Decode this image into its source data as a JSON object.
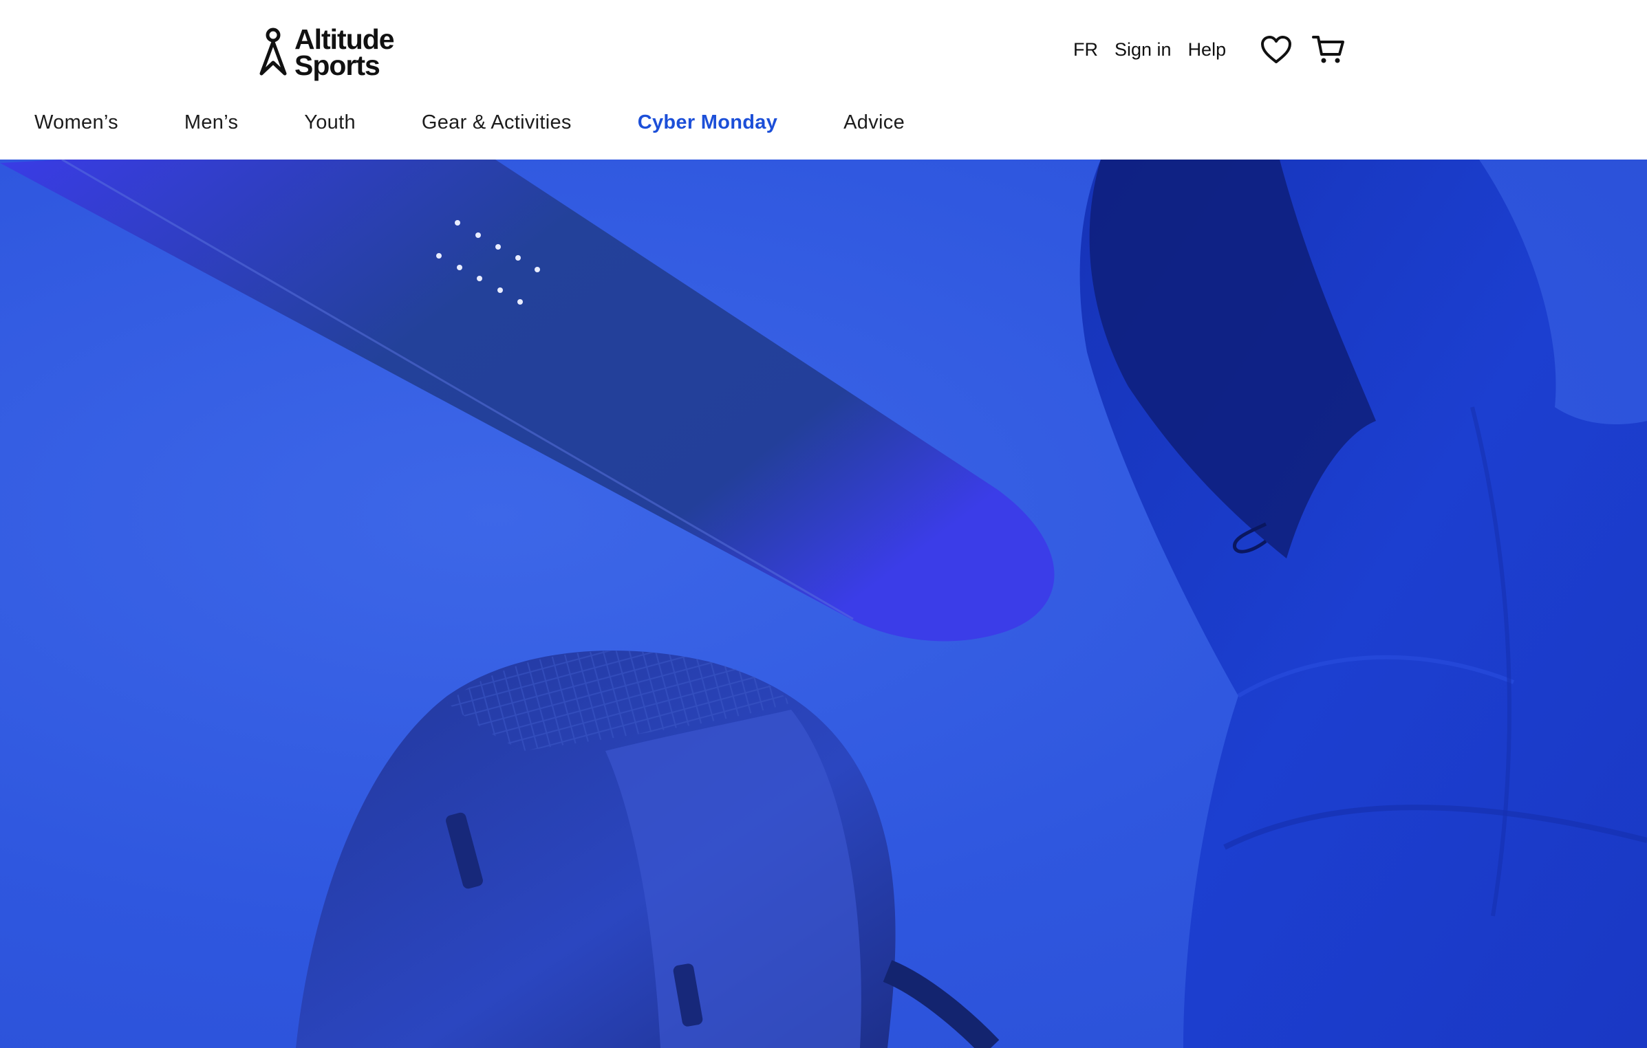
{
  "brand": {
    "name_line1": "Altitude",
    "name_line2": "Sports",
    "logo_icon": "altitude-sports-logo-icon"
  },
  "utility_nav": {
    "language": "FR",
    "sign_in": "Sign in",
    "help": "Help",
    "wishlist_icon": "heart-icon",
    "cart_icon": "shopping-cart-icon"
  },
  "main_nav": {
    "items": [
      {
        "label": "Women’s"
      },
      {
        "label": "Men’s"
      },
      {
        "label": "Youth"
      },
      {
        "label": "Gear & Activities"
      },
      {
        "label": "Cyber Monday",
        "highlight": true
      },
      {
        "label": "Advice"
      }
    ]
  },
  "colors": {
    "highlight": "#1c4fd8",
    "hero_background": "#2f57df"
  }
}
